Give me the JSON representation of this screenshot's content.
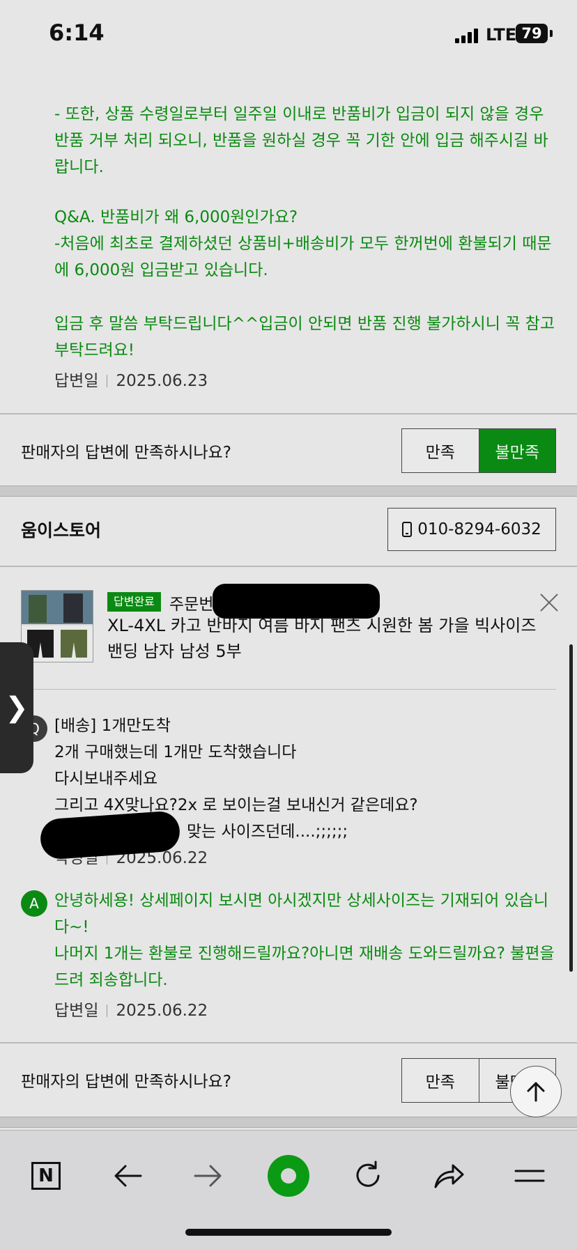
{
  "status_bar": {
    "time": "6:14",
    "network": "LTE",
    "battery": "79"
  },
  "answer1": {
    "paragraphs": [
      "- 또한, 상품 수령일로부터 일주일 이내로 반품비가 입금이 되지 않을 경우 반품 거부 처리 되오니, 반품을 원하실 경우 꼭 기한 안에 입금 해주시길 바랍니다.",
      "Q&A. 반품비가 왜 6,000원인가요?\n-처음에 최초로 결제하셨던 상품비+배송비가 모두 한꺼번에 환불되기 때문에 6,000원 입금받고 있습니다.",
      "입금 후 말씀 부탁드립니다^^입금이 안되면 반품 진행 불가하시니 꼭 참고 부탁드려요!"
    ],
    "date_label": "답변일",
    "date": "2025.06.23"
  },
  "satisfaction1": {
    "question": "판매자의 답변에 만족하시나요?",
    "yes": "만족",
    "no": "불만족"
  },
  "store": {
    "name": "움이스토어",
    "phone": "010-8294-6032"
  },
  "inquiry": {
    "badge": "답변완료",
    "order_label": "주문번호",
    "product_title": "XL-4XL 카고 반바지 여름 바지 팬츠 시원한 봄 가을 빅사이즈 밴딩 남자 남성 5부",
    "q_mark": "Q",
    "question_title": "[배송] 1개만도착",
    "question_lines": [
      "2개 구매했는데 1개만 도착했습니다",
      "다시보내주세요",
      "그리고 4X맞나요?2x 로 보이는걸 보내신거 같은데요?",
      "맞는 사이즈던데....;;;;;;"
    ],
    "q_date_label": "작성일",
    "q_date": "2025.06.22",
    "a_mark": "A",
    "answer_lines": [
      "안녕하세용! 상세페이지 보시면 아시겠지만 상세사이즈는 기재되어 있습니다~!",
      "나머지 1개는 환불로 진행해드릴까요?아니면 재배송 도와드릴까요? 불편을 드려 죄송합니다."
    ],
    "a_date_label": "답변일",
    "a_date": "2025.06.22"
  },
  "satisfaction2": {
    "question": "판매자의 답변에 만족하시나요?",
    "yes": "만족",
    "no": "불만족"
  },
  "side_tab": {
    "glyph": "❯"
  },
  "toolbar": {
    "naver_label": "N"
  },
  "colors": {
    "green": "#0b8a13",
    "answer_text": "#0a8a10",
    "background": "#e6e6e6"
  }
}
